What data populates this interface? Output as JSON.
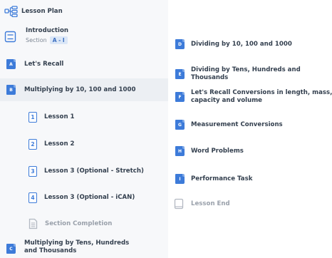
{
  "header": {
    "lesson_plan_label": "Lesson Plan",
    "lesson_plan_icon": "hierarchy-icon"
  },
  "intro": {
    "title": "Introduction",
    "section_label": "Section",
    "section_badge": "A - I",
    "icon": "document-icon"
  },
  "left_items": [
    {
      "letter": "A",
      "label": "Let's Recall"
    },
    {
      "letter": "B",
      "label": "Multiplying by 10, 100 and 1000"
    }
  ],
  "lessons": [
    {
      "number": "1",
      "label": "Lesson 1"
    },
    {
      "number": "2",
      "label": "Lesson 2"
    },
    {
      "number": "3",
      "label": "Lesson 3 (Optional - Stretch)"
    },
    {
      "number": "4",
      "label": "Lesson 3 (Optional - iCAN)"
    }
  ],
  "section_completion": {
    "label": "Section Completion",
    "icon": "completion-page-icon"
  },
  "left_bottom": {
    "letter": "C",
    "label": "Multiplying by Tens, Hundreds and Thousands"
  },
  "right_items": [
    {
      "letter": "D",
      "label": "Dividing by 10, 100 and 1000"
    },
    {
      "letter": "E",
      "label": "Dividing by Tens, Hundreds and Thousands"
    },
    {
      "letter": "F",
      "label": "Let's Recall Conversions in length, mass, capacity and volume"
    },
    {
      "letter": "G",
      "label": "Measurement Conversions"
    },
    {
      "letter": "H",
      "label": "Word Problems"
    },
    {
      "letter": "I",
      "label": "Performance Task"
    }
  ],
  "lesson_end": {
    "label": "Lesson End",
    "icon": "lesson-end-icon"
  },
  "colors": {
    "accent": "#3d7bd9",
    "selected_bg": "#eceff3",
    "badge_bg": "#dbe7f7"
  }
}
